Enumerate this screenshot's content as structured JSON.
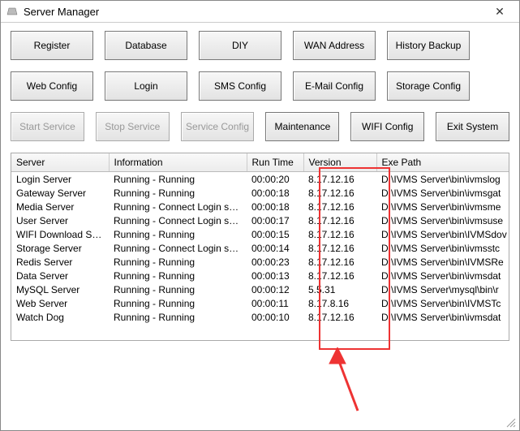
{
  "window": {
    "title": "Server Manager"
  },
  "buttons": {
    "row1": [
      {
        "label": "Register",
        "name": "register-button",
        "enabled": true
      },
      {
        "label": "Database",
        "name": "database-button",
        "enabled": true
      },
      {
        "label": "DIY",
        "name": "diy-button",
        "enabled": true
      },
      {
        "label": "WAN Address",
        "name": "wan-address-button",
        "enabled": true
      },
      {
        "label": "History Backup",
        "name": "history-backup-button",
        "enabled": true
      }
    ],
    "row2": [
      {
        "label": "Web Config",
        "name": "web-config-button",
        "enabled": true
      },
      {
        "label": "Login",
        "name": "login-button",
        "enabled": true
      },
      {
        "label": "SMS Config",
        "name": "sms-config-button",
        "enabled": true
      },
      {
        "label": "E-Mail Config",
        "name": "email-config-button",
        "enabled": true
      },
      {
        "label": "Storage Config",
        "name": "storage-config-button",
        "enabled": true
      }
    ],
    "row3": [
      {
        "label": "Start Service",
        "name": "start-service-button",
        "enabled": false
      },
      {
        "label": "Stop Service",
        "name": "stop-service-button",
        "enabled": false
      },
      {
        "label": "Service Config",
        "name": "service-config-button",
        "enabled": false
      },
      {
        "label": "Maintenance",
        "name": "maintenance-button",
        "enabled": true
      },
      {
        "label": "WIFI Config",
        "name": "wifi-config-button",
        "enabled": true
      },
      {
        "label": "Exit System",
        "name": "exit-system-button",
        "enabled": true
      }
    ]
  },
  "table": {
    "columns": [
      "Server",
      "Information",
      "Run Time",
      "Version",
      "Exe Path"
    ],
    "rows": [
      {
        "server": "Login Server",
        "info": "Running - Running",
        "runtime": "00:00:20",
        "version": "8.17.12.16",
        "path": "D:\\IVMS Server\\bin\\ivmslog"
      },
      {
        "server": "Gateway Server",
        "info": "Running - Running",
        "runtime": "00:00:18",
        "version": "8.17.12.16",
        "path": "D:\\IVMS Server\\bin\\ivmsgat"
      },
      {
        "server": "Media Server",
        "info": "Running - Connect Login serv...",
        "runtime": "00:00:18",
        "version": "8.17.12.16",
        "path": "D:\\IVMS Server\\bin\\ivmsme"
      },
      {
        "server": "User Server",
        "info": "Running - Connect Login serv...",
        "runtime": "00:00:17",
        "version": "8.17.12.16",
        "path": "D:\\IVMS Server\\bin\\ivmsuse"
      },
      {
        "server": "WIFI Download Server",
        "info": "Running - Running",
        "runtime": "00:00:15",
        "version": "8.17.12.16",
        "path": "D:\\IVMS Server\\bin\\IVMSdov"
      },
      {
        "server": "Storage Server",
        "info": "Running - Connect Login serv...",
        "runtime": "00:00:14",
        "version": "8.17.12.16",
        "path": "D:\\IVMS Server\\bin\\ivmsstc"
      },
      {
        "server": "Redis Server",
        "info": "Running - Running",
        "runtime": "00:00:23",
        "version": "8.17.12.16",
        "path": "D:\\IVMS Server\\bin\\IVMSRe"
      },
      {
        "server": "Data Server",
        "info": "Running - Running",
        "runtime": "00:00:13",
        "version": "8.17.12.16",
        "path": "D:\\IVMS Server\\bin\\ivmsdat"
      },
      {
        "server": "MySQL Server",
        "info": "Running - Running",
        "runtime": "00:00:12",
        "version": "5.5.31",
        "path": "D:\\IVMS Server\\mysql\\bin\\r"
      },
      {
        "server": "Web Server",
        "info": "Running - Running",
        "runtime": "00:00:11",
        "version": "8.17.8.16",
        "path": "D:\\IVMS Server\\bin\\IVMSTc"
      },
      {
        "server": "Watch Dog",
        "info": "Running - Running",
        "runtime": "00:00:10",
        "version": "8.17.12.16",
        "path": "D:\\IVMS Server\\bin\\ivmsdat"
      }
    ]
  },
  "annotation": {
    "highlight_column": "Version",
    "color": "#e33"
  }
}
